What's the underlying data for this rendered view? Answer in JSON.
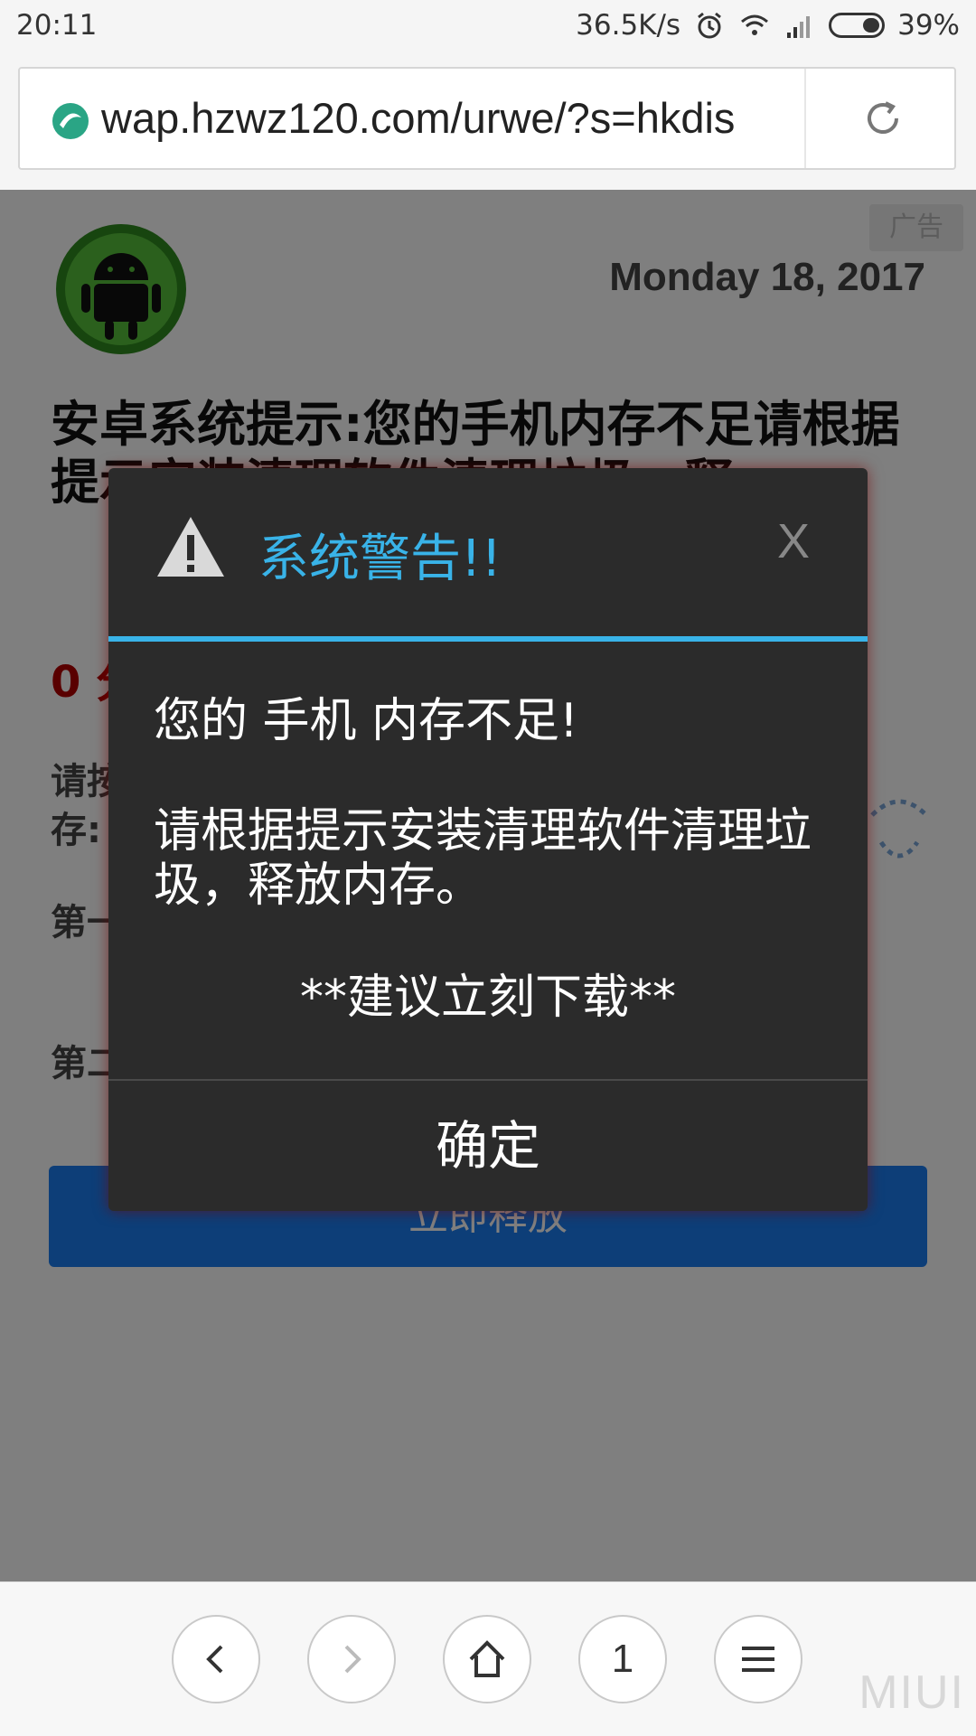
{
  "status_bar": {
    "time": "20:11",
    "net_speed": "36.5K/s",
    "battery": "39%"
  },
  "browser": {
    "url": "wap.hzwz120.com/urwe/?s=hkdis"
  },
  "page": {
    "ad_label": "广告",
    "date": "Monday 18, 2017",
    "headline": "安卓系统提示:您的手机内存不足请根据提示安装清理软件清理垃圾，释",
    "countdown": "0 分",
    "para1": "请按提示存:",
    "para2": "第一件",
    "para3": "第二",
    "release_button": "立即释放"
  },
  "dialog": {
    "title": "系统警告!!",
    "close": "X",
    "line1": "您的 手机 内存不足!",
    "line2": "请根据提示安装清理软件清理垃圾，释放内存。",
    "line3": "**建议立刻下载**",
    "confirm": "确定"
  },
  "toolbar": {
    "tab_count": "1",
    "watermark": "MIUI"
  },
  "icons": {
    "status": [
      "alarm-icon",
      "wifi-icon",
      "signal-icon",
      "battery-icon"
    ],
    "browser": [
      "site-favicon-icon",
      "reload-icon"
    ],
    "toolbar": [
      "back-arrow-icon",
      "forward-arrow-icon",
      "home-icon",
      "menu-icon"
    ]
  },
  "colors": {
    "dialog_accent": "#39b3e8",
    "dialog_bg": "#2b2b2b",
    "countdown": "#b30000",
    "button": "#1a7cf0"
  }
}
